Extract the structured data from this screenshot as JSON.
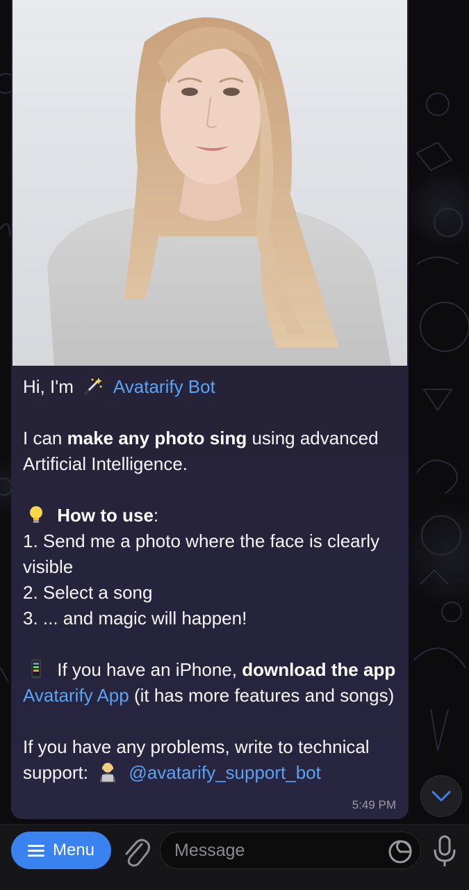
{
  "message": {
    "greeting_prefix": "Hi, I'm",
    "bot_name": "Avatarify Bot",
    "intro_prefix": "I can",
    "intro_bold": "make any photo sing",
    "intro_suffix": "using advanced Artificial Intelligence.",
    "howto_title": "How to use",
    "howto_colon": ":",
    "steps": [
      "1. Send me a photo where the face is clearly visible",
      "2. Select a song",
      "3. ... and magic will happen!"
    ],
    "iphone_prefix": "If you have an iPhone,",
    "iphone_bold": "download the app",
    "iphone_link": "Avatarify App",
    "iphone_suffix": "(it has more features and songs)",
    "support_text": "If you have any problems, write to technical support:",
    "support_link": "@avatarify_support_bot",
    "time": "5:49 PM"
  },
  "composer": {
    "menu_label": "Menu",
    "input_placeholder": "Message"
  },
  "icons": {
    "wand": "magic-wand-icon",
    "bulb": "light-bulb-icon",
    "phone": "mobile-phone-icon",
    "support": "person-with-laptop-icon",
    "menu": "hamburger-icon",
    "attach": "paperclip-icon",
    "sticker": "sticker-icon",
    "mic": "microphone-icon",
    "scroll": "chevron-down-icon"
  },
  "colors": {
    "accent": "#3a82f0",
    "link": "#5aa2f4",
    "bubble": "#27243a"
  }
}
